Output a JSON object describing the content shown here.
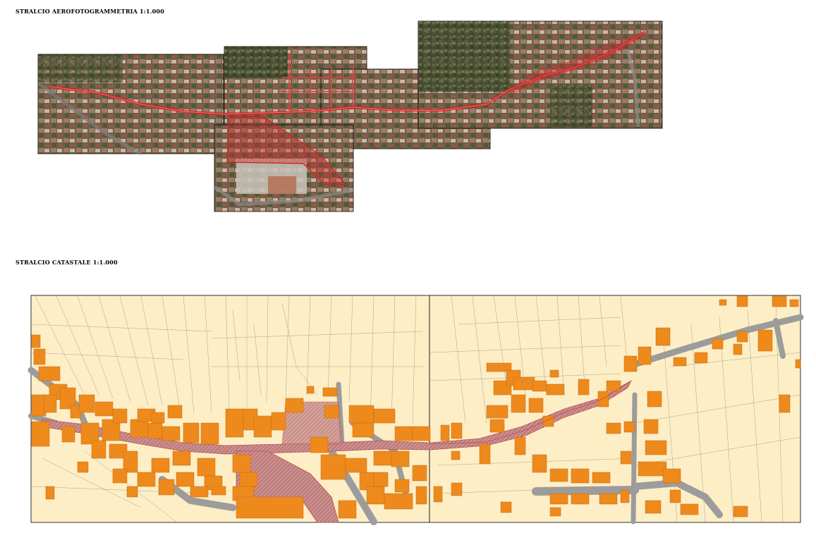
{
  "titles": {
    "aerial": "STRALCIO AEROFOTOGRAMMETRIA 1:1.000",
    "cadastral": "STRALCIO CATASTALE 1:1.000"
  },
  "colors": {
    "aerial_roof": "#8a6a55",
    "aerial_vegetation": "#3f4f2e",
    "intervention_highlight": "#c0392b",
    "cadastral_background": "#fdeec6",
    "cadastral_building": "#ee8a1c",
    "cadastral_road": "#9a9a9a",
    "cadastral_intervention": "#b78b8b",
    "parcel_line": "#9a9a86"
  }
}
